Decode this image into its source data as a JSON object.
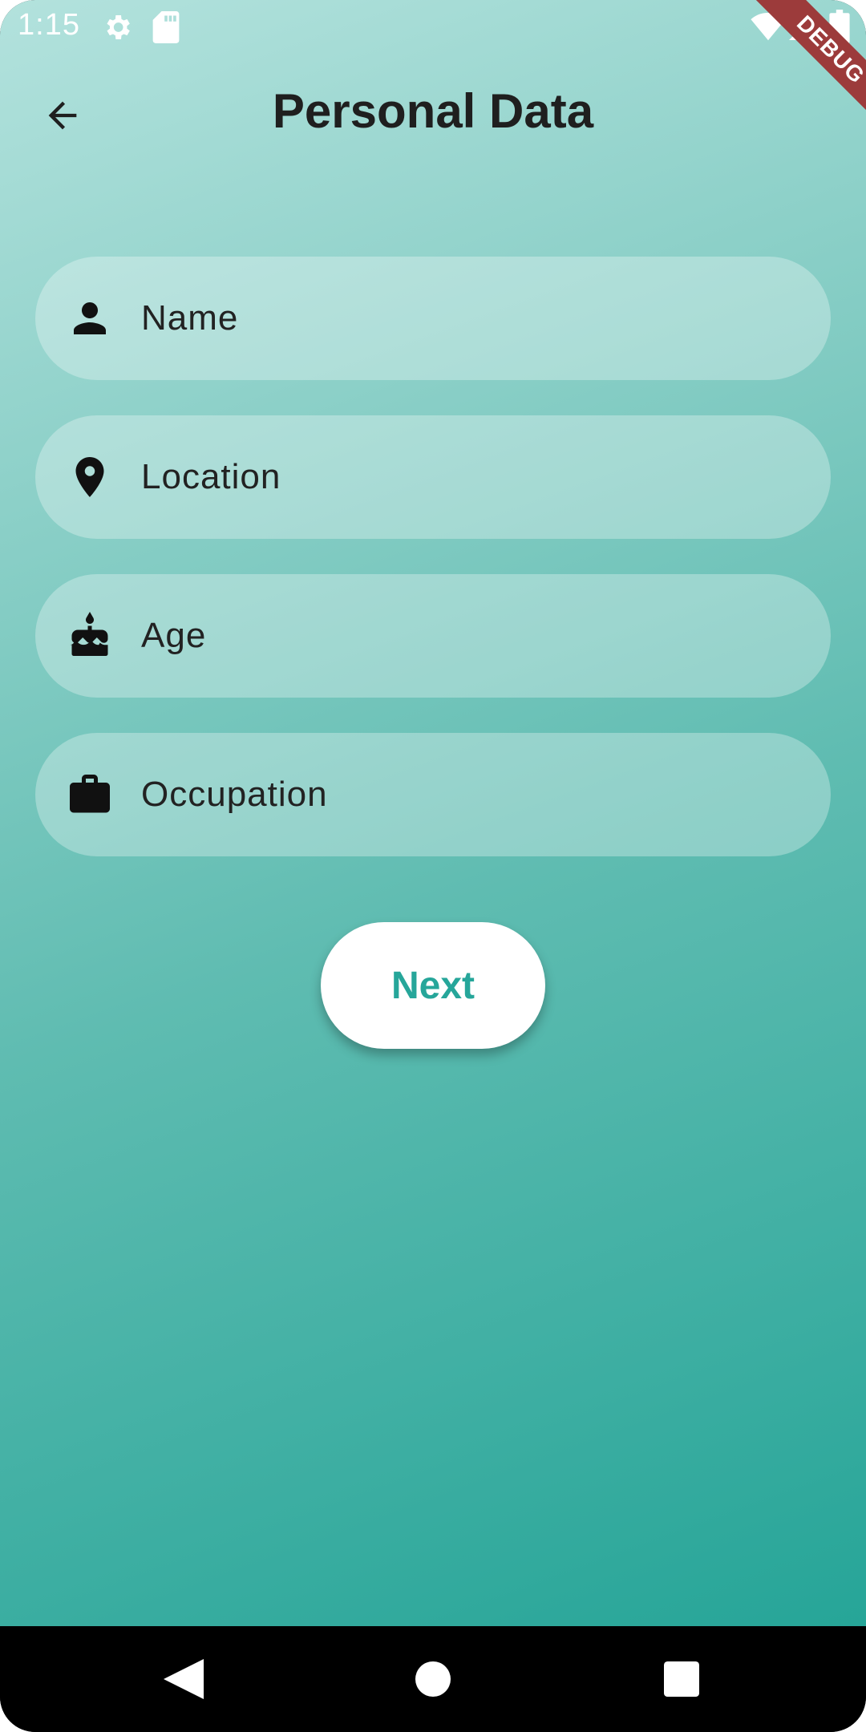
{
  "status_bar": {
    "time": "1:15",
    "icons": [
      "settings-icon",
      "sd-card-icon",
      "wifi-icon",
      "signal-icon",
      "battery-icon"
    ]
  },
  "debug_banner": "DEBUG",
  "app_bar": {
    "back_icon": "arrow-back-icon",
    "title": "Personal Data"
  },
  "form": {
    "fields": [
      {
        "icon": "person-icon",
        "placeholder": "Name",
        "value": ""
      },
      {
        "icon": "location-pin-icon",
        "placeholder": "Location",
        "value": ""
      },
      {
        "icon": "cake-icon",
        "placeholder": "Age",
        "value": ""
      },
      {
        "icon": "briefcase-icon",
        "placeholder": "Occupation",
        "value": ""
      }
    ],
    "next_label": "Next"
  },
  "nav_bar": {
    "icons": [
      "nav-back-icon",
      "nav-home-icon",
      "nav-recents-icon"
    ]
  },
  "colors": {
    "gradient_start": "#b3e2dd",
    "gradient_end": "#26a598",
    "accent": "#26a69a",
    "debug_banner": "#9c3b3b"
  }
}
